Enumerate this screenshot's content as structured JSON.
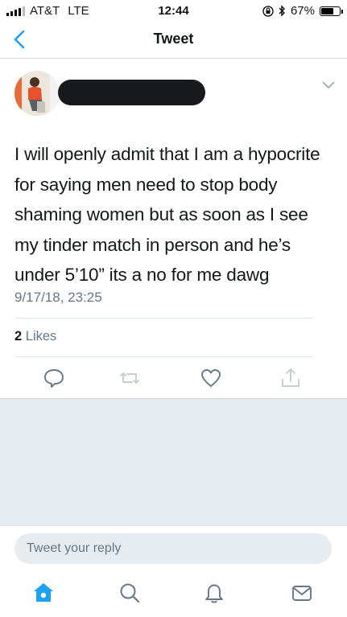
{
  "status_bar": {
    "carrier": "AT&T",
    "network": "LTE",
    "time": "12:44",
    "battery_percent": "67%",
    "battery_level": 0.67
  },
  "nav": {
    "title": "Tweet"
  },
  "tweet": {
    "text": "I will openly admit that I am a hypocrite for saying men need to stop body shaming women but as soon as I see my tinder match in person and he’s under 5’10” its a no for me dawg",
    "timestamp": "9/17/18, 23:25",
    "likes_count": "2",
    "likes_label": "Likes"
  },
  "reply": {
    "placeholder": "Tweet your reply"
  },
  "icons": {
    "back": "chevron-left-icon",
    "more": "chevron-down-icon",
    "reply": "reply-icon",
    "retweet": "retweet-icon",
    "like": "heart-icon",
    "share": "share-icon",
    "home": "home-icon",
    "search": "search-icon",
    "notifications": "bell-icon",
    "messages": "envelope-icon"
  },
  "colors": {
    "accent": "#1da1f2",
    "secondary_text": "#657786",
    "gray_background": "#e6ecf0"
  }
}
